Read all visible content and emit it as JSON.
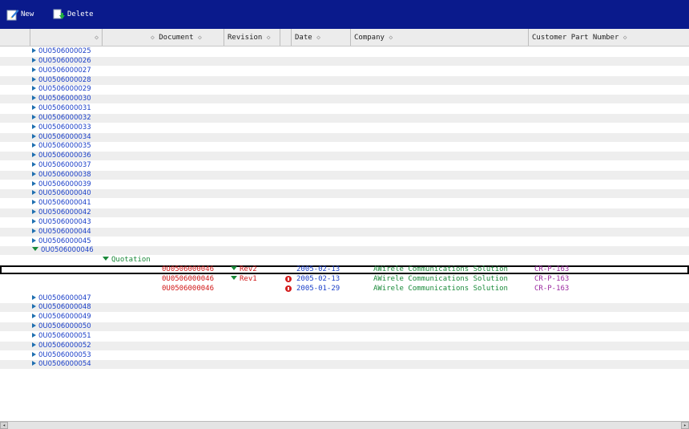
{
  "toolbar": {
    "new_label": "New",
    "delete_label": "Delete"
  },
  "columns": [
    {
      "label": "",
      "sort": "◇"
    },
    {
      "label": "Document",
      "sort": "◇"
    },
    {
      "label": "Revision",
      "sort": "◇"
    },
    {
      "label": "Date",
      "sort": "◇"
    },
    {
      "label": "Company",
      "sort": "◇"
    },
    {
      "label": "Customer Part Number",
      "sort": "◇"
    }
  ],
  "sort_prefix": "◇",
  "nodes_before": [
    "0U0506000025",
    "0U0506000026",
    "0U0506000027",
    "0U0506000028",
    "0U0506000029",
    "0U0506000030",
    "0U0506000031",
    "0U0506000032",
    "0U0506000033",
    "0U0506000034",
    "0U0506000035",
    "0U0506000036",
    "0U0506000037",
    "0U0506000038",
    "0U0506000039",
    "0U0506000040",
    "0U0506000041",
    "0U0506000042",
    "0U0506000043",
    "0U0506000044",
    "0U0506000045"
  ],
  "expanded_node": "0U0506000046",
  "quotation_label": "Quotation",
  "records": [
    {
      "document": "0U0506000046",
      "revision": "Rev2",
      "date": "2005-02-13",
      "company": "AWirele Communications Solution",
      "part": "CR-P-163"
    },
    {
      "document": "0U0506000046",
      "revision": "Rev1",
      "date": "2005-02-13",
      "company": "AWirele Communications Solution",
      "part": "CR-P-163"
    },
    {
      "document": "0U0506000046",
      "revision": "",
      "date": "2005-01-29",
      "company": "AWirele Communications Solution",
      "part": "CR-P-163"
    }
  ],
  "nodes_after": [
    "0U0506000047",
    "0U0506000048",
    "0U0506000049",
    "0U0506000050",
    "0U0506000051",
    "0U0506000052",
    "0U0506000053",
    "0U0506000054"
  ]
}
